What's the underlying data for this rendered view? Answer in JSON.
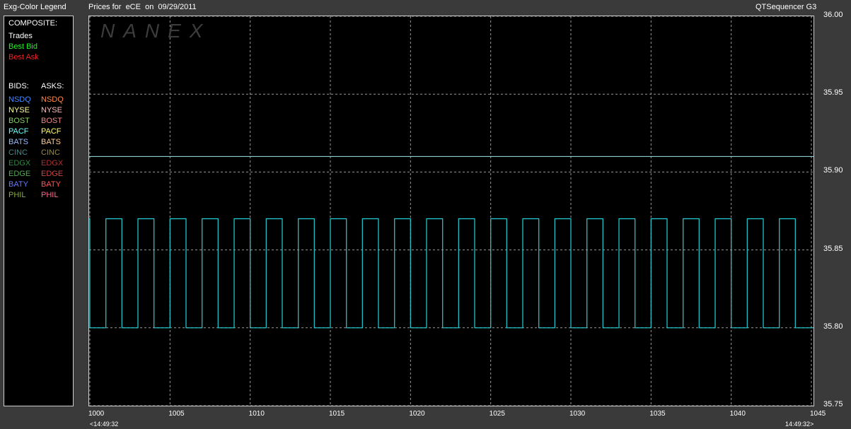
{
  "header": {
    "legend_title": "Exg-Color Legend",
    "chart_title": "Prices for  eCE  on  09/29/2011",
    "app_name": "QTSequencer G3"
  },
  "legend": {
    "composite_label": "COMPOSITE:",
    "composite": [
      {
        "label": "Trades",
        "color": "#ffffff"
      },
      {
        "label": "Best Bid",
        "color": "#22ee22"
      },
      {
        "label": "Best Ask",
        "color": "#ee2222"
      }
    ],
    "bids_label": "BIDS:",
    "asks_label": "ASKS:",
    "bids": [
      {
        "label": "NSDQ",
        "color": "#4488ff"
      },
      {
        "label": "NYSE",
        "color": "#ffff99"
      },
      {
        "label": "BOST",
        "color": "#88cc66"
      },
      {
        "label": "PACF",
        "color": "#66ffff"
      },
      {
        "label": "BATS",
        "color": "#99bbff"
      },
      {
        "label": "CINC",
        "color": "#448888"
      },
      {
        "label": "EDGX",
        "color": "#338844"
      },
      {
        "label": "EDGE",
        "color": "#55aa55"
      },
      {
        "label": "BATY",
        "color": "#6677ff"
      },
      {
        "label": "PHIL",
        "color": "#88aa44"
      }
    ],
    "asks": [
      {
        "label": "NSDQ",
        "color": "#ff8844"
      },
      {
        "label": "NYSE",
        "color": "#ffbbbb"
      },
      {
        "label": "BOST",
        "color": "#ee8888"
      },
      {
        "label": "PACF",
        "color": "#ffff66"
      },
      {
        "label": "BATS",
        "color": "#ffcc88"
      },
      {
        "label": "CINC",
        "color": "#998844"
      },
      {
        "label": "EDGX",
        "color": "#aa3333"
      },
      {
        "label": "EDGE",
        "color": "#cc4444"
      },
      {
        "label": "BATY",
        "color": "#ff5555"
      },
      {
        "label": "PHIL",
        "color": "#ff6688"
      }
    ]
  },
  "watermark": "NANEX",
  "chart_data": {
    "type": "line",
    "title": "Prices for  eCE  on  09/29/2011",
    "xlim": [
      1000,
      1045
    ],
    "ylim": [
      35.75,
      36.0
    ],
    "x_ticks": [
      "1000",
      "1005",
      "1010",
      "1015",
      "1020",
      "1025",
      "1030",
      "1035",
      "1040",
      "1045"
    ],
    "y_ticks": [
      "36.00",
      "35.95",
      "35.90",
      "35.85",
      "35.80",
      "35.75"
    ],
    "time_start_label": "<14:49:32",
    "time_end_label": "14:49:32>",
    "grid": true,
    "series": [
      {
        "role": "Best Ask",
        "color": "#a0e8e8",
        "y": 35.91
      },
      {
        "role": "oscillating quote",
        "color": "#22d0d8",
        "high": 35.87,
        "low": 35.8,
        "transitions": [
          0.0,
          1.0,
          2.0,
          3.0,
          4.0,
          5.0,
          6.0,
          7.0,
          8.0,
          9.0,
          10.0,
          11.0,
          12.0,
          13.0,
          14.0,
          15.0,
          16.0,
          17.0,
          18.0,
          19.0,
          20.0,
          21.0,
          22.0,
          23.0,
          24.0,
          25.0,
          26.0,
          27.0,
          28.0,
          29.0,
          30.0,
          31.0,
          32.0,
          33.0,
          34.0,
          35.0,
          36.0,
          37.0,
          38.0,
          39.0,
          40.0,
          41.0,
          42.0,
          43.0,
          44.0
        ]
      }
    ]
  }
}
